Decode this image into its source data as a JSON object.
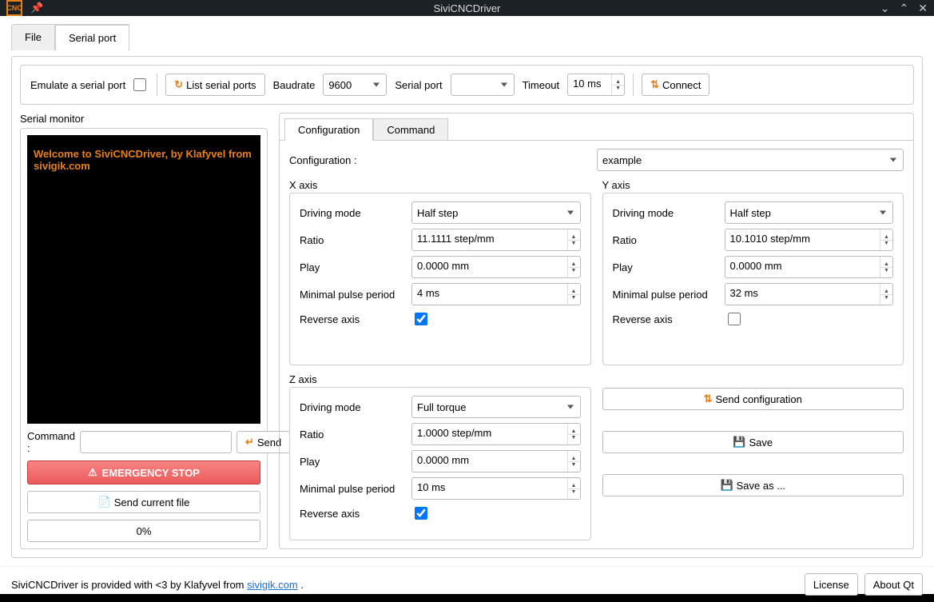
{
  "titlebar": {
    "title": "SiviCNCDriver",
    "app_icon_text": "CNC"
  },
  "tabs": {
    "file": "File",
    "serial": "Serial port"
  },
  "topbar": {
    "emulate": "Emulate a serial port",
    "list_ports": "List serial ports",
    "baudrate_label": "Baudrate",
    "baudrate_value": "9600",
    "serial_port_label": "Serial port",
    "serial_port_value": "",
    "timeout_label": "Timeout",
    "timeout_value": "10 ms",
    "connect": "Connect"
  },
  "serial_monitor": {
    "title": "Serial monitor",
    "welcome": "Welcome to SiviCNCDriver, by Klafyvel from sivigik.com",
    "command_label": "Command :",
    "send": "Send",
    "estop": "EMERGENCY STOP",
    "send_file": "Send current file",
    "progress": "0%"
  },
  "subtabs": {
    "configuration": "Configuration",
    "command": "Command"
  },
  "configuration": {
    "label": "Configuration :",
    "selected": "example",
    "x_axis": "X axis",
    "y_axis": "Y axis",
    "z_axis": "Z axis",
    "driving_mode": "Driving mode",
    "ratio": "Ratio",
    "play": "Play",
    "min_pulse": "Minimal pulse period",
    "reverse": "Reverse axis",
    "x": {
      "mode": "Half step",
      "ratio": "11.1111 step/mm",
      "play": "0.0000 mm",
      "pulse": "4 ms",
      "reverse": true
    },
    "y": {
      "mode": "Half step",
      "ratio": "10.1010 step/mm",
      "play": "0.0000  mm",
      "pulse": "32 ms",
      "reverse": false
    },
    "z": {
      "mode": "Full torque",
      "ratio": "1.0000 step/mm",
      "play": "0.0000 mm",
      "pulse": "10 ms",
      "reverse": true
    },
    "send_config": "Send configuration",
    "save": "Save",
    "save_as": "Save as ..."
  },
  "footer": {
    "text_pre": "SiviCNCDriver is provided with <3 by Klafyvel from ",
    "link": "sivigik.com",
    "text_post": " .",
    "license": "License",
    "about": "About Qt"
  }
}
